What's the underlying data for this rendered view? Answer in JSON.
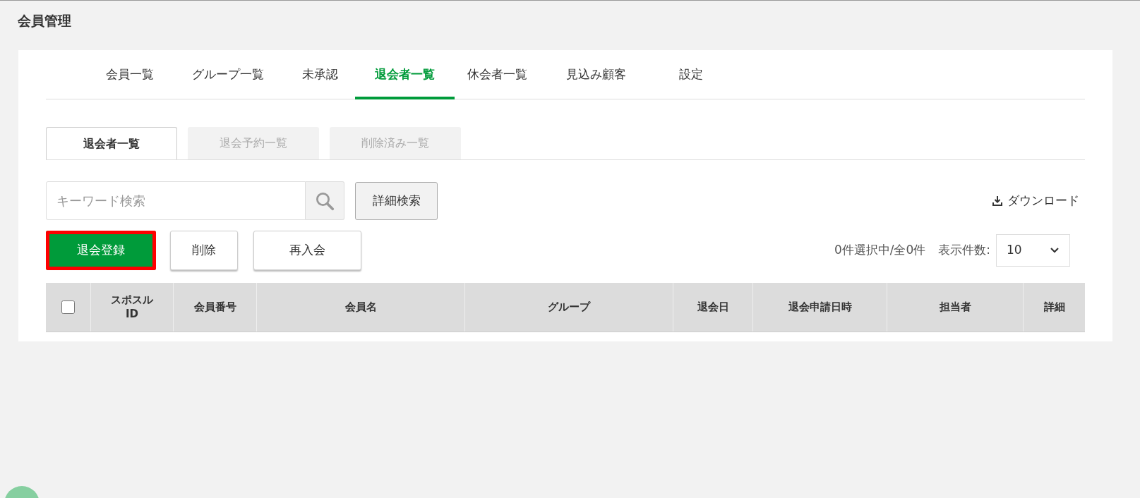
{
  "page_title": "会員管理",
  "tabs": [
    {
      "label": "会員一覧",
      "selected": false
    },
    {
      "label": "グループ一覧",
      "selected": false
    },
    {
      "label": "未承認",
      "selected": false
    },
    {
      "label": "退会者一覧",
      "selected": true
    },
    {
      "label": "休会者一覧",
      "selected": false
    },
    {
      "label": "見込み顧客",
      "selected": false
    },
    {
      "label": "設定",
      "selected": false
    }
  ],
  "sub_tabs": [
    {
      "label": "退会者一覧",
      "selected": true
    },
    {
      "label": "退会予約一覧",
      "selected": false
    },
    {
      "label": "削除済み一覧",
      "selected": false
    }
  ],
  "search": {
    "placeholder": "キーワード検索",
    "advanced_button": "詳細検索"
  },
  "download": "ダウンロード",
  "actions": [
    {
      "label": "退会登録",
      "kind": "primary",
      "highlighted": true
    },
    {
      "label": "削除",
      "kind": "secondary",
      "highlighted": false
    },
    {
      "label": "再入会",
      "kind": "secondary",
      "highlighted": false
    }
  ],
  "selection_count": "0件選択中/全0件",
  "page_size": {
    "label": "表示件数:",
    "value": "10"
  },
  "table": {
    "select_all_checked": false,
    "columns": [
      "スポスル\nID",
      "会員番号",
      "会員名",
      "グループ",
      "退会日",
      "退会申請日時",
      "担当者",
      "詳細"
    ]
  }
}
